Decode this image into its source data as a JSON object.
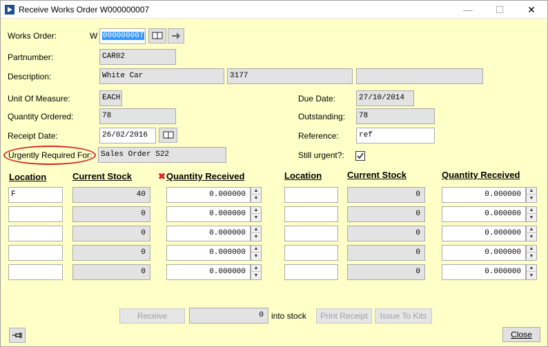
{
  "window": {
    "title": "Receive Works Order W000000007",
    "minimize": "—",
    "maximize": "☐",
    "close": "✕"
  },
  "form": {
    "works_order_label": "Works Order:",
    "works_order_prefix": "W",
    "works_order_value": "000000007",
    "partnumber_label": "Partnumber:",
    "partnumber_value": "CAR02",
    "description_label": "Description:",
    "description_1": "White Car",
    "description_2": "3177",
    "description_3": "",
    "uom_label": "Unit Of Measure:",
    "uom_value": "EACH",
    "qty_ordered_label": "Quantity Ordered:",
    "qty_ordered_value": "78",
    "receipt_date_label": "Receipt Date:",
    "receipt_date_value": "26/02/2016",
    "urgent_label": "Urgently Required For:",
    "urgent_value": "Sales Order S22",
    "due_date_label": "Due Date:",
    "due_date_value": "27/10/2014",
    "outstanding_label": "Outstanding:",
    "outstanding_value": "78",
    "reference_label": "Reference:",
    "reference_value": "ref",
    "still_urgent_label": "Still urgent?:",
    "still_urgent_checked": true
  },
  "grid": {
    "headers_left": {
      "location": "Location",
      "current_stock": "Current Stock",
      "qty_received": "Quantity Received"
    },
    "headers_right": {
      "location": "Location",
      "current_stock": "Current Stock",
      "qty_received": "Quantity Received"
    },
    "left_rows": [
      {
        "location": "F",
        "stock": "40",
        "qty": "0.000000"
      },
      {
        "location": "",
        "stock": "0",
        "qty": "0.000000"
      },
      {
        "location": "",
        "stock": "0",
        "qty": "0.000000"
      },
      {
        "location": "",
        "stock": "0",
        "qty": "0.000000"
      },
      {
        "location": "",
        "stock": "0",
        "qty": "0.000000"
      }
    ],
    "right_rows": [
      {
        "location": "",
        "stock": "0",
        "qty": "0.000000"
      },
      {
        "location": "",
        "stock": "0",
        "qty": "0.000000"
      },
      {
        "location": "",
        "stock": "0",
        "qty": "0.000000"
      },
      {
        "location": "",
        "stock": "0",
        "qty": "0.000000"
      },
      {
        "location": "",
        "stock": "0",
        "qty": "0.000000"
      }
    ]
  },
  "footer": {
    "receive_label": "Receive",
    "receive_qty": "0",
    "into_stock_label": "into stock",
    "print_receipt_label": "Print Receipt",
    "issue_to_kits_label": "Issue To Kits",
    "close_label": "Close"
  },
  "colors": {
    "form_bg": "#ffffc8",
    "field_bg": "#e3e3e3",
    "highlight_ellipse": "#d9242a",
    "selection": "#3399ff"
  }
}
